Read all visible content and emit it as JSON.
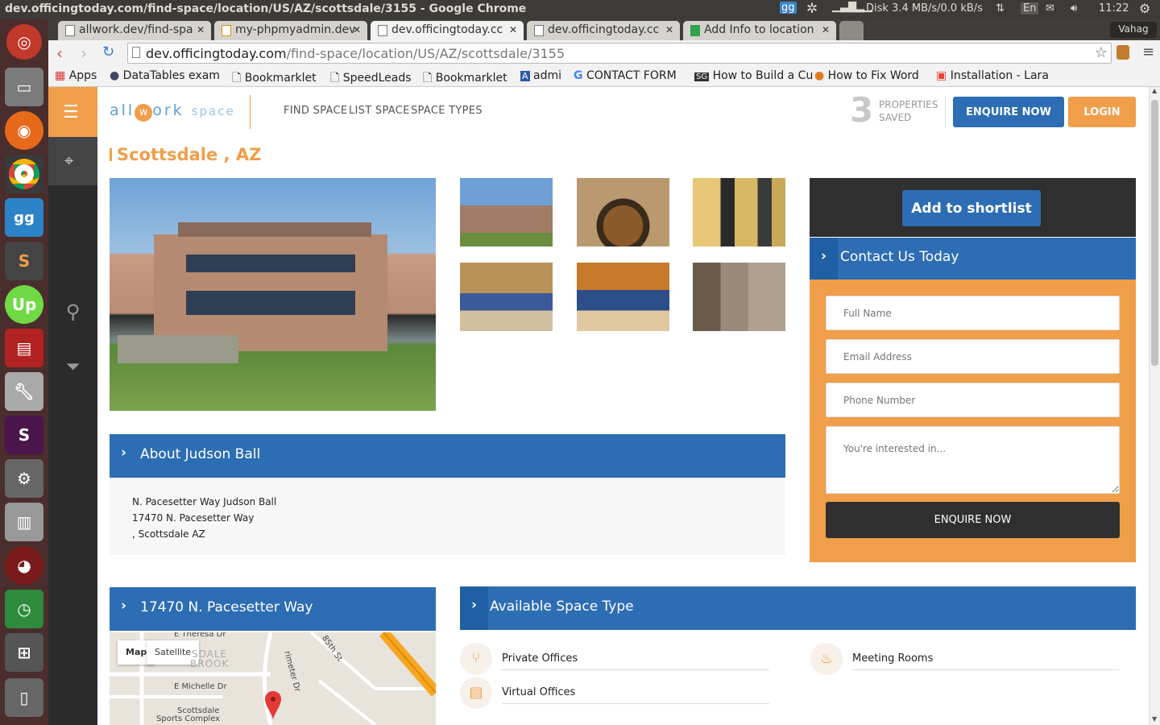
{
  "window": {
    "title": "dev.officingtoday.com/find-space/location/US/AZ/scottsdale/3155 - Google Chrome",
    "disk": "Disk 3.4 MB/s/0.0 kB/s",
    "lang": "En",
    "clock": "11:22",
    "user": "Vahag"
  },
  "tabs": [
    {
      "label": "allwork.dev/find-spa"
    },
    {
      "label": "my-phpmyadmin.dev"
    },
    {
      "label": "dev.officingtoday.cc"
    },
    {
      "label": "dev.officingtoday.cc"
    },
    {
      "label": "Add Info to location"
    }
  ],
  "address": {
    "host": "dev.officingtoday.com",
    "path": "/find-space/location/US/AZ/scottsdale/3155"
  },
  "bookmarks": [
    "Apps",
    "DataTables exam",
    "Bookmarklet",
    "SpeedLeads",
    "Bookmarklet",
    "admi",
    "CONTACT FORM",
    "How to Build a Cu",
    "How to Fix Word",
    "Installation - Lara"
  ],
  "site": {
    "logo": {
      "pre": "all",
      "w": "w",
      "post": "ork",
      "sub": "space"
    },
    "nav": [
      "FIND SPACE",
      "LIST SPACE",
      "SPACE TYPES"
    ],
    "saved_count": "3",
    "saved_label1": "PROPERTIES",
    "saved_label2": "SAVED",
    "enquire_btn": "ENQUIRE NOW",
    "login_btn": "LOGIN"
  },
  "listing": {
    "title": "Scottsdale , AZ",
    "about_title": "About Judson Ball",
    "about_lines": [
      "N. Pacesetter Way Judson Ball",
      "17470 N. Pacesetter Way",
      ", Scottsdale AZ"
    ],
    "map_title": "17470 N. Pacesetter Way",
    "map_map": "Map",
    "map_satellite": "Satellite",
    "map_labels": [
      "E Theresa Dr",
      "SDALE",
      "BROOK",
      "E Michelle Dr",
      "Scottsdale",
      "Sports Complex",
      "rimeter Dr",
      "85th St"
    ]
  },
  "sidebox": {
    "shortlist_btn": "Add to shortlist",
    "contact_title": "Contact Us Today",
    "fullname_ph": "Full Name",
    "email_ph": "Email Address",
    "phone_ph": "Phone Number",
    "message_ph": "You're interested in...",
    "submit_btn": "ENQUIRE NOW"
  },
  "spaces": {
    "title": "Available Space Type",
    "items": [
      "Private Offices",
      "Meeting Rooms",
      "Virtual Offices"
    ]
  },
  "colors": {
    "orange": "#f09e4a",
    "blue": "#2d6db3",
    "dark": "#2f2f2f"
  }
}
